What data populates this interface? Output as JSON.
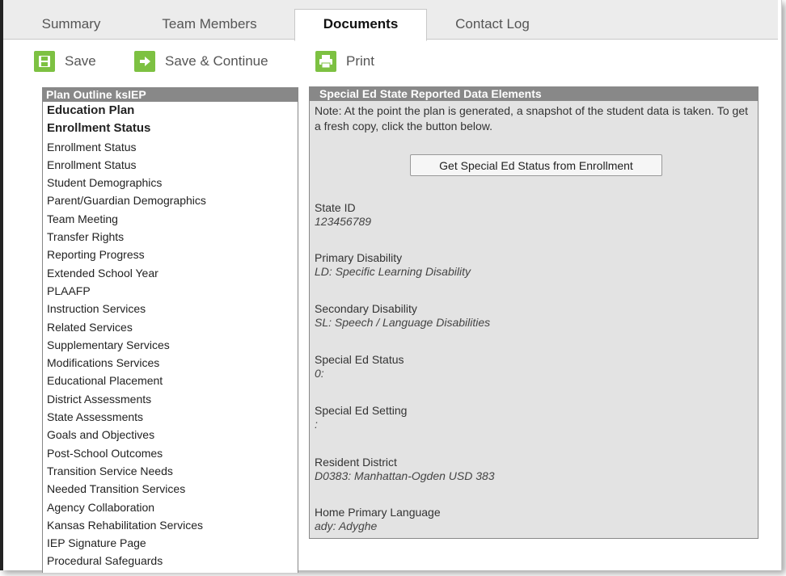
{
  "tabs": [
    {
      "label": "Summary"
    },
    {
      "label": "Team Members"
    },
    {
      "label": "Documents"
    },
    {
      "label": "Contact Log"
    }
  ],
  "toolbar": {
    "save_label": "Save",
    "save_continue_label": "Save & Continue",
    "print_label": "Print"
  },
  "outline": {
    "title": "Plan Outline ksIEP",
    "items": [
      {
        "label": "Education Plan"
      },
      {
        "label": "Enrollment Status"
      },
      {
        "label": "Enrollment Status"
      },
      {
        "label": "Enrollment Status"
      },
      {
        "label": "Student Demographics"
      },
      {
        "label": "Parent/Guardian Demographics"
      },
      {
        "label": "Team Meeting"
      },
      {
        "label": "Transfer Rights"
      },
      {
        "label": "Reporting Progress"
      },
      {
        "label": "Extended School Year"
      },
      {
        "label": "PLAAFP"
      },
      {
        "label": "Instruction Services"
      },
      {
        "label": "Related Services"
      },
      {
        "label": "Supplementary Services"
      },
      {
        "label": "Modifications Services"
      },
      {
        "label": "Educational Placement"
      },
      {
        "label": "District Assessments"
      },
      {
        "label": "State Assessments"
      },
      {
        "label": "Goals and Objectives"
      },
      {
        "label": "Post-School Outcomes"
      },
      {
        "label": "Transition Service Needs"
      },
      {
        "label": "Needed Transition Services"
      },
      {
        "label": "Agency Collaboration"
      },
      {
        "label": "Kansas Rehabilitation Services"
      },
      {
        "label": "IEP Signature Page"
      },
      {
        "label": "Procedural Safeguards"
      }
    ]
  },
  "panel": {
    "title": "Special Ed State Reported Data Elements",
    "note": "Note: At the point the plan is generated, a snapshot of the student data is taken. To get a fresh copy, click the button below.",
    "button_label": "Get Special Ed Status from Enrollment",
    "fields": [
      {
        "label": "State ID",
        "value": "123456789"
      },
      {
        "label": "Primary Disability",
        "value": "LD: Specific Learning Disability"
      },
      {
        "label": "Secondary Disability",
        "value": "SL: Speech / Language Disabilities"
      },
      {
        "label": "Special Ed Status",
        "value": "0:"
      },
      {
        "label": "Special Ed Setting",
        "value": ":"
      },
      {
        "label": "Resident District",
        "value": "D0383: Manhattan-Ogden USD 383"
      },
      {
        "label": "Home Primary Language",
        "value": "ady: Adyghe"
      }
    ]
  },
  "colors": {
    "accent_green": "#7dc142",
    "header_gray": "#888888",
    "panel_bg": "#e3e3e3"
  }
}
